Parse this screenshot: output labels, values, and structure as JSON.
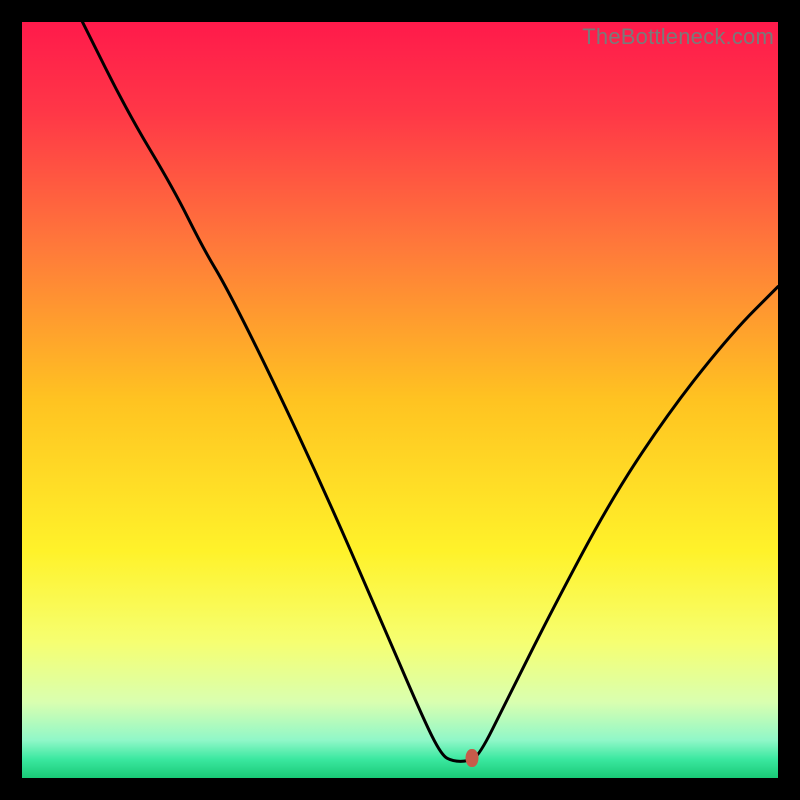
{
  "watermark": "TheBottleneck.com",
  "chart_data": {
    "type": "line",
    "title": "",
    "xlabel": "",
    "ylabel": "",
    "xlim": [
      0,
      100
    ],
    "ylim": [
      0,
      100
    ],
    "grid": false,
    "legend": false,
    "gradient_stops": [
      {
        "offset": 0.0,
        "color": "#ff1a4b"
      },
      {
        "offset": 0.12,
        "color": "#ff3747"
      },
      {
        "offset": 0.3,
        "color": "#ff7a3a"
      },
      {
        "offset": 0.5,
        "color": "#ffc321"
      },
      {
        "offset": 0.7,
        "color": "#fff22a"
      },
      {
        "offset": 0.82,
        "color": "#f6ff71"
      },
      {
        "offset": 0.9,
        "color": "#d9ffb0"
      },
      {
        "offset": 0.95,
        "color": "#90f7c8"
      },
      {
        "offset": 0.975,
        "color": "#3be8a0"
      },
      {
        "offset": 1.0,
        "color": "#19c976"
      }
    ],
    "series": [
      {
        "name": "bottleneck-curve",
        "color": "#000000",
        "points": [
          {
            "x": 8.0,
            "y": 100.0
          },
          {
            "x": 14.0,
            "y": 88.0
          },
          {
            "x": 20.0,
            "y": 78.0
          },
          {
            "x": 24.0,
            "y": 70.0
          },
          {
            "x": 27.0,
            "y": 65.0
          },
          {
            "x": 33.0,
            "y": 53.0
          },
          {
            "x": 40.0,
            "y": 38.0
          },
          {
            "x": 47.0,
            "y": 22.0
          },
          {
            "x": 53.0,
            "y": 8.0
          },
          {
            "x": 55.5,
            "y": 3.0
          },
          {
            "x": 57.0,
            "y": 2.2
          },
          {
            "x": 59.0,
            "y": 2.2
          },
          {
            "x": 60.5,
            "y": 3.0
          },
          {
            "x": 64.0,
            "y": 10.0
          },
          {
            "x": 70.0,
            "y": 22.0
          },
          {
            "x": 78.0,
            "y": 37.0
          },
          {
            "x": 86.0,
            "y": 49.0
          },
          {
            "x": 94.0,
            "y": 59.0
          },
          {
            "x": 100.0,
            "y": 65.0
          }
        ]
      }
    ],
    "marker": {
      "x": 59.5,
      "y": 2.6,
      "color": "#c65b4a"
    }
  }
}
